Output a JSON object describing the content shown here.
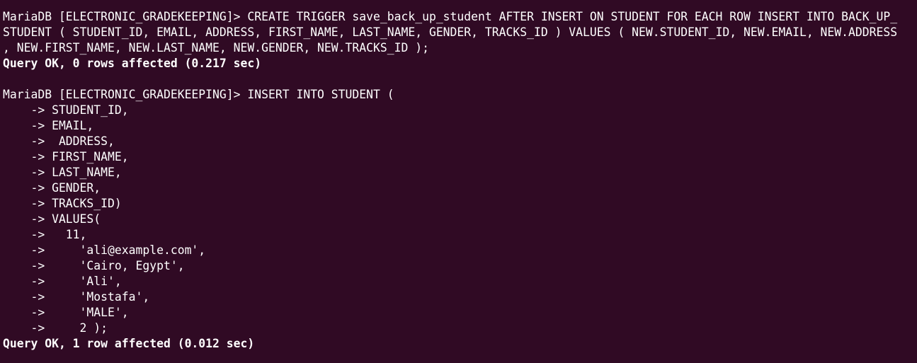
{
  "terminal": {
    "background_color": "#300a24",
    "text_color": "#ffffff",
    "lines": [
      {
        "text": "MariaDB [ELECTRONIC_GRADEKEEPING]> CREATE TRIGGER save_back_up_student AFTER INSERT ON STUDENT FOR EACH ROW INSERT INTO BACK_UP_",
        "bold": false
      },
      {
        "text": "STUDENT ( STUDENT_ID, EMAIL, ADDRESS, FIRST_NAME, LAST_NAME, GENDER, TRACKS_ID ) VALUES ( NEW.STUDENT_ID, NEW.EMAIL, NEW.ADDRESS",
        "bold": false
      },
      {
        "text": ", NEW.FIRST_NAME, NEW.LAST_NAME, NEW.GENDER, NEW.TRACKS_ID );",
        "bold": false
      },
      {
        "text": "Query OK, 0 rows affected (0.217 sec)",
        "bold": true
      },
      {
        "text": "",
        "bold": false
      },
      {
        "text": "MariaDB [ELECTRONIC_GRADEKEEPING]> INSERT INTO STUDENT (",
        "bold": false
      },
      {
        "text": "    -> STUDENT_ID,",
        "bold": false
      },
      {
        "text": "    -> EMAIL,",
        "bold": false
      },
      {
        "text": "    ->  ADDRESS,",
        "bold": false
      },
      {
        "text": "    -> FIRST_NAME,",
        "bold": false
      },
      {
        "text": "    -> LAST_NAME,",
        "bold": false
      },
      {
        "text": "    -> GENDER,",
        "bold": false
      },
      {
        "text": "    -> TRACKS_ID)",
        "bold": false
      },
      {
        "text": "    -> VALUES(",
        "bold": false
      },
      {
        "text": "    ->   11,",
        "bold": false
      },
      {
        "text": "    ->     'ali@example.com',",
        "bold": false
      },
      {
        "text": "    ->     'Cairo, Egypt',",
        "bold": false
      },
      {
        "text": "    ->     'Ali',",
        "bold": false
      },
      {
        "text": "    ->     'Mostafa',",
        "bold": false
      },
      {
        "text": "    ->     'MALE',",
        "bold": false
      },
      {
        "text": "    ->     2 );",
        "bold": false
      },
      {
        "text": "Query OK, 1 row affected (0.012 sec)",
        "bold": true
      }
    ]
  }
}
